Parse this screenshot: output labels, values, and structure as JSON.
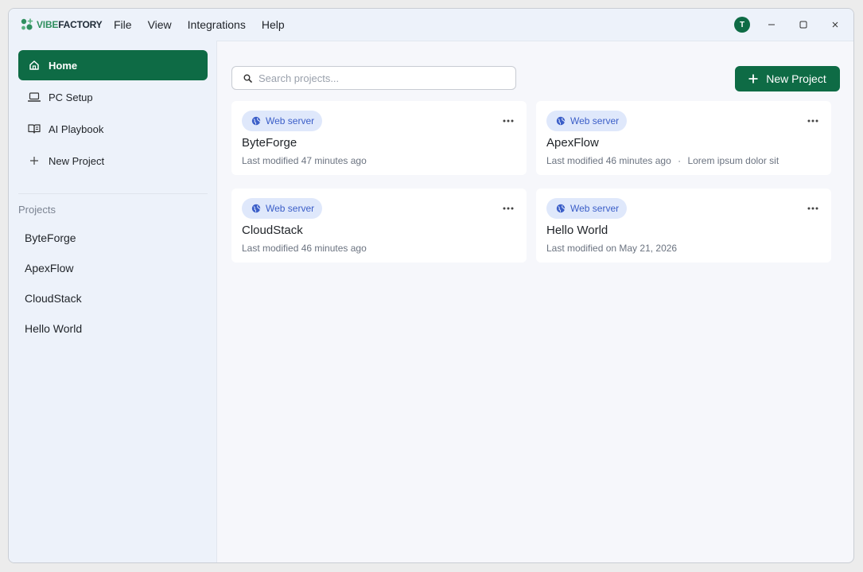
{
  "app": {
    "logo_vibe": "VIBE",
    "logo_factory": "FACTORY",
    "menu": [
      "File",
      "View",
      "Integrations",
      "Help"
    ],
    "avatar_initial": "T"
  },
  "sidebar": {
    "items": [
      {
        "label": "Home",
        "icon": "home-icon"
      },
      {
        "label": "PC Setup",
        "icon": "laptop-icon"
      },
      {
        "label": "AI Playbook",
        "icon": "book-icon"
      },
      {
        "label": "New Project",
        "icon": "plus-icon"
      }
    ],
    "projects_heading": "Projects",
    "projects": [
      "ByteForge",
      "ApexFlow",
      "CloudStack",
      "Hello World"
    ]
  },
  "main": {
    "search_placeholder": "Search projects...",
    "new_project_label": "New Project",
    "cards": [
      {
        "badge": "Web server",
        "title": "ByteForge",
        "modified": "Last modified 47 minutes ago",
        "description": ""
      },
      {
        "badge": "Web server",
        "title": "ApexFlow",
        "modified": "Last modified 46 minutes ago",
        "description": "Lorem ipsum dolor sit"
      },
      {
        "badge": "Web server",
        "title": "CloudStack",
        "modified": "Last modified 46 minutes ago",
        "description": ""
      },
      {
        "badge": "Web server",
        "title": "Hello World",
        "modified": "Last modified on May 21, 2026",
        "description": ""
      }
    ]
  },
  "colors": {
    "accent": "#0e6b45",
    "badge_bg": "#dfe8fb",
    "badge_text": "#3b5ec8"
  }
}
